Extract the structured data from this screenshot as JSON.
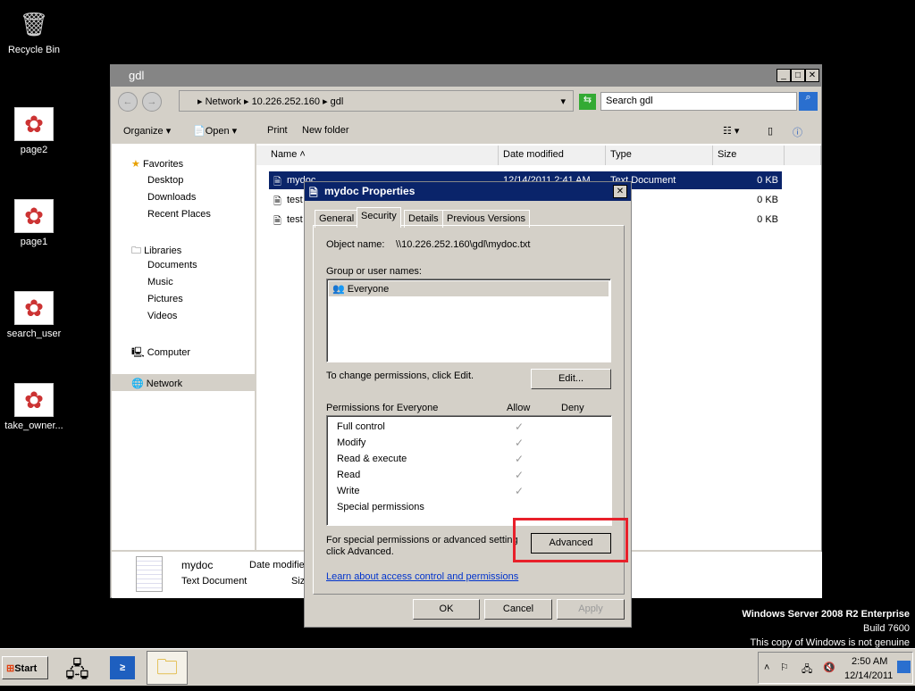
{
  "desktop": {
    "icons": [
      "Recycle Bin",
      "page2",
      "page1",
      "search_user",
      "take_owner..."
    ]
  },
  "explorer": {
    "title": "gdl",
    "breadcrumb": [
      "Network",
      "10.226.252.160",
      "gdl"
    ],
    "search_placeholder": "Search gdl",
    "toolbar": {
      "organize": "Organize",
      "open": "Open",
      "print": "Print",
      "new_folder": "New folder"
    },
    "nav": {
      "favorites": "Favorites",
      "desktop": "Desktop",
      "downloads": "Downloads",
      "recent": "Recent Places",
      "libraries": "Libraries",
      "documents": "Documents",
      "music": "Music",
      "pictures": "Pictures",
      "videos": "Videos",
      "computer": "Computer",
      "network": "Network"
    },
    "columns": [
      "Name",
      "Date modified",
      "Type",
      "Size"
    ],
    "files": [
      {
        "name": "mydoc",
        "date": "12/14/2011 2:41 AM",
        "type": "Text Document",
        "size": "0 KB"
      },
      {
        "name": "test",
        "date": "",
        "type": "",
        "size": "0 KB"
      },
      {
        "name": "test",
        "date": "",
        "type": "",
        "size": "0 KB"
      }
    ],
    "details": {
      "name": "mydoc",
      "type": "Text Document",
      "date_label": "Date modifie",
      "size_label": "Siz"
    }
  },
  "dialog": {
    "title": "mydoc Properties",
    "tabs": [
      "General",
      "Security",
      "Details",
      "Previous Versions"
    ],
    "object_label": "Object name:",
    "object_value": "\\\\10.226.252.160\\gdl\\mydoc.txt",
    "group_label": "Group or user names:",
    "groups": [
      "Everyone"
    ],
    "change_text": "To change permissions, click Edit.",
    "edit": "Edit...",
    "perm_label": "Permissions for Everyone",
    "allow": "Allow",
    "deny": "Deny",
    "permissions": [
      {
        "name": "Full control",
        "allow": true
      },
      {
        "name": "Modify",
        "allow": true
      },
      {
        "name": "Read & execute",
        "allow": true
      },
      {
        "name": "Read",
        "allow": true
      },
      {
        "name": "Write",
        "allow": true
      },
      {
        "name": "Special permissions",
        "allow": false
      }
    ],
    "special_text1": "For special permissions or advanced settings,",
    "special_text2": "click Advanced.",
    "advanced": "Advanced",
    "link": "Learn about access control and permissions",
    "ok": "OK",
    "cancel": "Cancel",
    "apply": "Apply"
  },
  "watermark": {
    "line1": "Windows Server 2008 R2 Enterprise",
    "line2": "Build 7600",
    "line3": "This copy of Windows is not genuine"
  },
  "taskbar": {
    "start": "Start",
    "time": "2:50 AM",
    "date": "12/14/2011"
  },
  "highlight_color": "#e8202a"
}
